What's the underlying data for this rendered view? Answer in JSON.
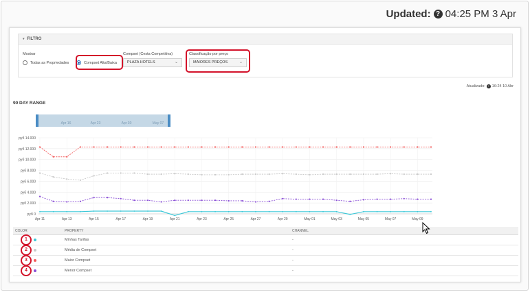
{
  "header": {
    "updated_label": "Updated:",
    "updated_time": "04:25 PM 3 Apr"
  },
  "filter": {
    "title": "FILTRO",
    "mostrar_label": "Mostrar",
    "radio_all": "Todas as Propriedades",
    "radio_compset": "Compset Alta/Baixa",
    "compset_label": "Compset (Cesta Competitiva)",
    "compset_value": "PLAZA HOTELS",
    "classificacao_label": "Classificação por preço",
    "classificacao_value": "MAIORES PREÇOS"
  },
  "atualizado": {
    "label": "Atualizado:",
    "value": "16:24 10 Abr"
  },
  "range": {
    "title": "90 DAY RANGE",
    "navigator_labels": [
      "Apr 16",
      "Apr 23",
      "Apr 30",
      "May 07"
    ]
  },
  "chart_data": {
    "type": "line",
    "x": [
      "Apr 11",
      "Apr 12",
      "Apr 13",
      "Apr 14",
      "Apr 15",
      "Apr 16",
      "Apr 17",
      "Apr 18",
      "Apr 19",
      "Apr 20",
      "Apr 21",
      "Apr 22",
      "Apr 23",
      "Apr 24",
      "Apr 25",
      "Apr 26",
      "Apr 27",
      "Apr 28",
      "Apr 29",
      "Apr 30",
      "May 01",
      "May 02",
      "May 03",
      "May 04",
      "May 05",
      "May 06",
      "May 07",
      "May 08",
      "May 09",
      "May 10"
    ],
    "x_tick_labels": [
      "Apr 11",
      "Apr 13",
      "Apr 15",
      "Apr 17",
      "Apr 19",
      "Apr 21",
      "Apr 23",
      "Apr 25",
      "Apr 27",
      "Apr 29",
      "May 01",
      "May 03",
      "May 05",
      "May 07",
      "May 09"
    ],
    "y_tick_labels": [
      "руб 0",
      "руб 2.000",
      "руб 4.000",
      "руб 6.000",
      "руб 8.000",
      "руб 10.000",
      "руб 12.000",
      "руб 14.000"
    ],
    "ylim": [
      0,
      14000
    ],
    "grid": true,
    "series": [
      {
        "color": "#3ec8d8",
        "values": [
          400,
          400,
          400,
          400,
          500,
          500,
          500,
          500,
          500,
          500,
          -300,
          400,
          400,
          400,
          400,
          400,
          400,
          400,
          400,
          400,
          400,
          400,
          400,
          -100,
          400,
          400,
          400,
          400,
          400,
          400
        ]
      },
      {
        "color": "#c9c9c9",
        "values": [
          7500,
          6800,
          6400,
          6200,
          7000,
          7500,
          7500,
          7500,
          7300,
          7300,
          7400,
          7300,
          7200,
          7200,
          7200,
          7300,
          7300,
          7300,
          7400,
          7300,
          7200,
          7300,
          7300,
          7300,
          7300,
          7300,
          7400,
          7300,
          7300,
          7300
        ]
      },
      {
        "color": "#f25c5c",
        "values": [
          12300,
          10500,
          10500,
          12300,
          12300,
          12300,
          12300,
          12300,
          12300,
          12300,
          12300,
          12300,
          12300,
          12300,
          12300,
          12300,
          12300,
          12300,
          12300,
          12300,
          12300,
          12300,
          12300,
          12300,
          12300,
          12300,
          12300,
          12300,
          12300,
          12300
        ]
      },
      {
        "color": "#8a4fd6",
        "values": [
          3200,
          2300,
          2200,
          2300,
          3000,
          3000,
          2800,
          2500,
          2500,
          2200,
          2500,
          2500,
          2500,
          2500,
          2400,
          2400,
          2200,
          2300,
          2800,
          2700,
          2700,
          2700,
          2500,
          2300,
          2600,
          2700,
          2700,
          2800,
          2700,
          2700
        ]
      }
    ]
  },
  "legend": {
    "col_color": "COLOR",
    "col_property": "PROPERTY",
    "col_channel": "CHANNEL",
    "rows": [
      {
        "num": "1",
        "color": "#3ec8d8",
        "property": "Minhas Tarifas",
        "channel": "-"
      },
      {
        "num": "2",
        "color": "#c9c9c9",
        "property": "Média de Compset",
        "channel": "-"
      },
      {
        "num": "3",
        "color": "#f25c5c",
        "property": "Maior Compset",
        "channel": "-"
      },
      {
        "num": "4",
        "color": "#8a4fd6",
        "property": "Menor Compset",
        "channel": "-"
      }
    ]
  }
}
